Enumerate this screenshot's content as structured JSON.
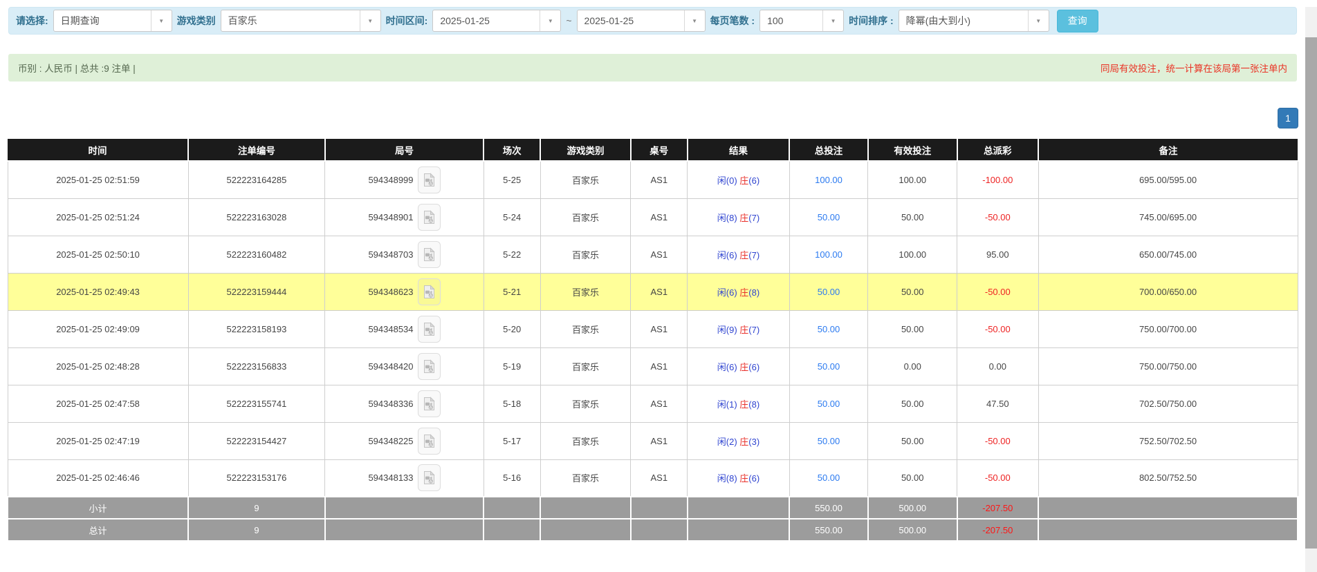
{
  "filter_bar": {
    "select_label": "请选择:",
    "select_value": "日期查询",
    "game_label": "游戏类别",
    "game_value": "百家乐",
    "range_label": "时间区间:",
    "date_from": "2025-01-25",
    "range_separator": "~",
    "date_to": "2025-01-25",
    "page_size_label": "每页笔数 :",
    "page_size_value": "100",
    "sort_label": "时间排序 :",
    "sort_value": "降幂(由大到小)",
    "search_button": "查询"
  },
  "info_bar": {
    "summary": "币别 : 人民币 | 总共 :9 注单 |",
    "notice": "同局有效投注，统一计算在该局第一张注单内"
  },
  "pagination": {
    "current_page": "1"
  },
  "table": {
    "columns": [
      "时间",
      "注单编号",
      "局号",
      "场次",
      "游戏类别",
      "桌号",
      "结果",
      "总投注",
      "有效投注",
      "总派彩",
      "备注"
    ],
    "round_icon": "video-replay-icon",
    "rows": [
      {
        "time": "2025-01-25 02:51:59",
        "bet_id": "522223164285",
        "round_id": "594348999",
        "session": "5-25",
        "game": "百家乐",
        "table_id": "AS1",
        "result_player": "闲(0)",
        "result_banker": "庄",
        "result_banker_points": "(6)",
        "total_bet": "100.00",
        "valid_bet": "100.00",
        "payout": "-100.00",
        "remark": "695.00/595.00",
        "highlighted": false
      },
      {
        "time": "2025-01-25 02:51:24",
        "bet_id": "522223163028",
        "round_id": "594348901",
        "session": "5-24",
        "game": "百家乐",
        "table_id": "AS1",
        "result_player": "闲(8)",
        "result_banker": "庄",
        "result_banker_points": "(7)",
        "total_bet": "50.00",
        "valid_bet": "50.00",
        "payout": "-50.00",
        "remark": "745.00/695.00",
        "highlighted": false
      },
      {
        "time": "2025-01-25 02:50:10",
        "bet_id": "522223160482",
        "round_id": "594348703",
        "session": "5-22",
        "game": "百家乐",
        "table_id": "AS1",
        "result_player": "闲(6)",
        "result_banker": "庄",
        "result_banker_points": "(7)",
        "total_bet": "100.00",
        "valid_bet": "100.00",
        "payout": "95.00",
        "remark": "650.00/745.00",
        "highlighted": false
      },
      {
        "time": "2025-01-25 02:49:43",
        "bet_id": "522223159444",
        "round_id": "594348623",
        "session": "5-21",
        "game": "百家乐",
        "table_id": "AS1",
        "result_player": "闲(6)",
        "result_banker": "庄",
        "result_banker_points": "(8)",
        "total_bet": "50.00",
        "valid_bet": "50.00",
        "payout": "-50.00",
        "remark": "700.00/650.00",
        "highlighted": true
      },
      {
        "time": "2025-01-25 02:49:09",
        "bet_id": "522223158193",
        "round_id": "594348534",
        "session": "5-20",
        "game": "百家乐",
        "table_id": "AS1",
        "result_player": "闲(9)",
        "result_banker": "庄",
        "result_banker_points": "(7)",
        "total_bet": "50.00",
        "valid_bet": "50.00",
        "payout": "-50.00",
        "remark": "750.00/700.00",
        "highlighted": false
      },
      {
        "time": "2025-01-25 02:48:28",
        "bet_id": "522223156833",
        "round_id": "594348420",
        "session": "5-19",
        "game": "百家乐",
        "table_id": "AS1",
        "result_player": "闲(6)",
        "result_banker": "庄",
        "result_banker_points": "(6)",
        "total_bet": "50.00",
        "valid_bet": "0.00",
        "payout": "0.00",
        "remark": "750.00/750.00",
        "highlighted": false
      },
      {
        "time": "2025-01-25 02:47:58",
        "bet_id": "522223155741",
        "round_id": "594348336",
        "session": "5-18",
        "game": "百家乐",
        "table_id": "AS1",
        "result_player": "闲(1)",
        "result_banker": "庄",
        "result_banker_points": "(8)",
        "total_bet": "50.00",
        "valid_bet": "50.00",
        "payout": "47.50",
        "remark": "702.50/750.00",
        "highlighted": false
      },
      {
        "time": "2025-01-25 02:47:19",
        "bet_id": "522223154427",
        "round_id": "594348225",
        "session": "5-17",
        "game": "百家乐",
        "table_id": "AS1",
        "result_player": "闲(2)",
        "result_banker": "庄",
        "result_banker_points": "(3)",
        "total_bet": "50.00",
        "valid_bet": "50.00",
        "payout": "-50.00",
        "remark": "752.50/702.50",
        "highlighted": false
      },
      {
        "time": "2025-01-25 02:46:46",
        "bet_id": "522223153176",
        "round_id": "594348133",
        "session": "5-16",
        "game": "百家乐",
        "table_id": "AS1",
        "result_player": "闲(8)",
        "result_banker": "庄",
        "result_banker_points": "(6)",
        "total_bet": "50.00",
        "valid_bet": "50.00",
        "payout": "-50.00",
        "remark": "802.50/752.50",
        "highlighted": false
      }
    ],
    "footer_rows": [
      {
        "label": "小计",
        "count": "9",
        "total_bet": "550.00",
        "valid_bet": "500.00",
        "payout": "-207.50"
      },
      {
        "label": "总计",
        "count": "9",
        "total_bet": "550.00",
        "valid_bet": "500.00",
        "payout": "-207.50"
      }
    ]
  },
  "colors": {
    "filter_bar_blue": "#d9edf7",
    "info_bar_green": "#dff0d8",
    "notice_red": "#ea3325",
    "header_black": "#1b1b1b",
    "footer_gray": "#9c9c9c",
    "highlight_yellow": "#ffff99",
    "link_blue": "#2b7af0",
    "result_player_blue": "#2f44d0",
    "result_banker_red": "#e9302a",
    "negative_red": "#ee2222",
    "search_button_blue": "#5bc0de",
    "pager_blue": "#337ab7"
  }
}
